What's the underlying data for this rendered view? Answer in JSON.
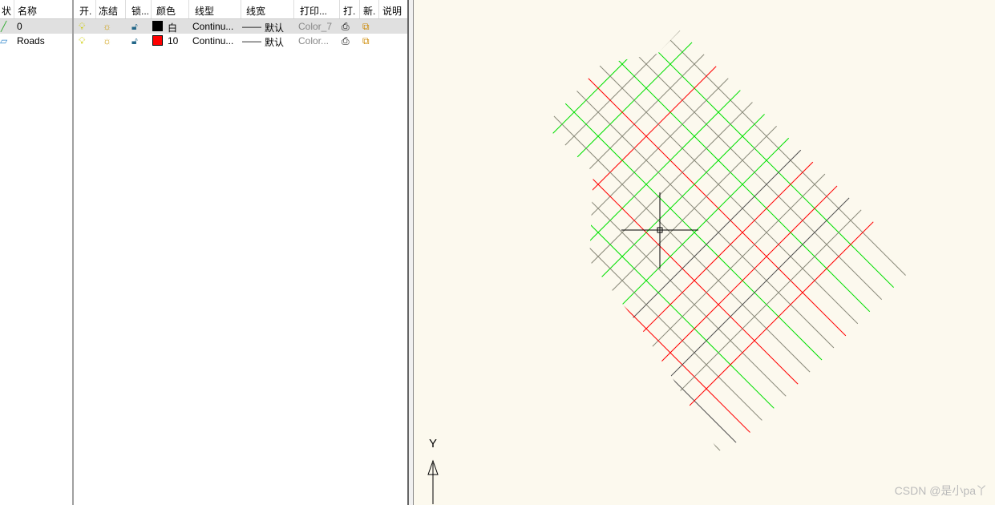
{
  "tree": {
    "headers": {
      "status": "状",
      "name": "名称"
    },
    "rows": [
      {
        "name": "0"
      },
      {
        "name": "Roads"
      }
    ]
  },
  "table": {
    "headers": {
      "on": "开.",
      "freeze": "冻结",
      "lock": "锁...",
      "color": "颜色",
      "linetype": "线型",
      "lineweight": "线宽",
      "plotstyle": "打印...",
      "plot": "打.",
      "newvp": "新.",
      "desc": "说明"
    },
    "rows": [
      {
        "color_name": "白",
        "color_hex": "#000000",
        "linetype": "Continu...",
        "lineweight": "默认",
        "plotstyle": "Color_7",
        "desc": ""
      },
      {
        "color_name": "10",
        "color_hex": "#ff0000",
        "linetype": "Continu...",
        "lineweight": "默认",
        "plotstyle": "Color...",
        "desc": ""
      }
    ]
  },
  "canvas": {
    "ucs_y_label": "Y",
    "watermark": "CSDN @是小pa丫",
    "colors": {
      "gray": "#8a8a7a",
      "green": "#00e000",
      "red": "#ff0000",
      "dark": "#505050"
    }
  }
}
